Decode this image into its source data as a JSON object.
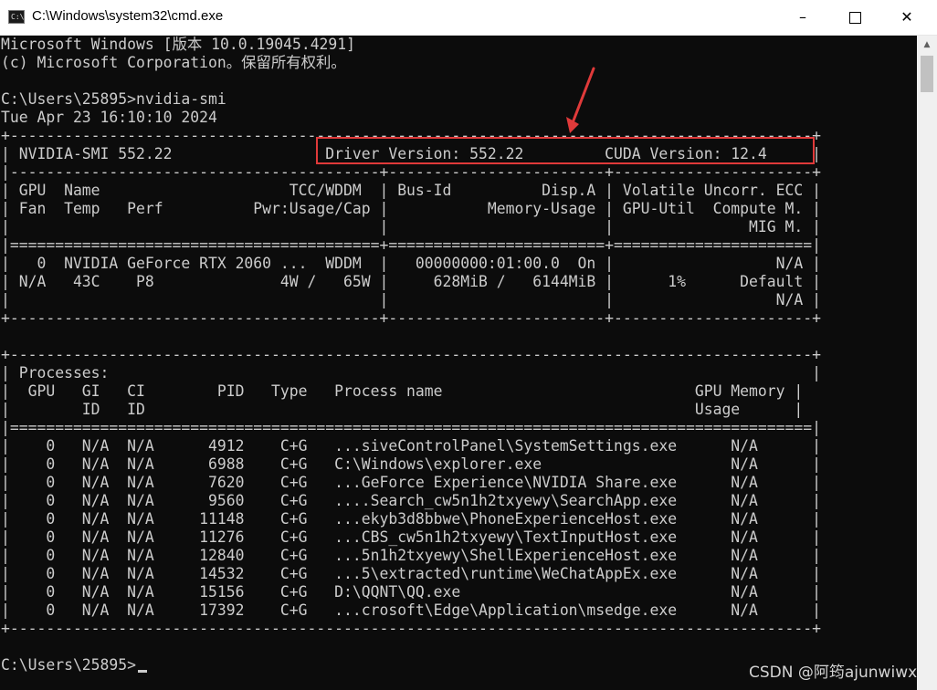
{
  "window": {
    "title": "C:\\Windows\\system32\\cmd.exe",
    "icon_text": "C:\\",
    "buttons": {
      "minimize": "–",
      "close": "✕"
    }
  },
  "console": {
    "lines": [
      "Microsoft Windows [版本 10.0.19045.4291]",
      "(c) Microsoft Corporation。保留所有权利。",
      "",
      "C:\\Users\\25895>nvidia-smi",
      "Tue Apr 23 16:10:10 2024",
      "+-----------------------------------------------------------------------------------------+",
      "| NVIDIA-SMI 552.22                 Driver Version: 552.22         CUDA Version: 12.4     |",
      "|-----------------------------------------+------------------------+----------------------+",
      "| GPU  Name                     TCC/WDDM  | Bus-Id          Disp.A | Volatile Uncorr. ECC |",
      "| Fan  Temp   Perf          Pwr:Usage/Cap |           Memory-Usage | GPU-Util  Compute M. |",
      "|                                         |                        |               MIG M. |",
      "|=========================================+========================+======================|",
      "|   0  NVIDIA GeForce RTX 2060 ...  WDDM  |   00000000:01:00.0  On |                  N/A |",
      "| N/A   43C    P8              4W /   65W |     628MiB /   6144MiB |      1%      Default |",
      "|                                         |                        |                  N/A |",
      "+-----------------------------------------+------------------------+----------------------+",
      "",
      "+-----------------------------------------------------------------------------------------+",
      "| Processes:                                                                              |",
      "|  GPU   GI   CI        PID   Type   Process name                            GPU Memory |",
      "|        ID   ID                                                             Usage      |",
      "|=========================================================================================|",
      "|    0   N/A  N/A      4912    C+G   ...siveControlPanel\\SystemSettings.exe      N/A      |",
      "|    0   N/A  N/A      6988    C+G   C:\\Windows\\explorer.exe                     N/A      |",
      "|    0   N/A  N/A      7620    C+G   ...GeForce Experience\\NVIDIA Share.exe      N/A      |",
      "|    0   N/A  N/A      9560    C+G   ....Search_cw5n1h2txyewy\\SearchApp.exe      N/A      |",
      "|    0   N/A  N/A     11148    C+G   ...ekyb3d8bbwe\\PhoneExperienceHost.exe      N/A      |",
      "|    0   N/A  N/A     11276    C+G   ...CBS_cw5n1h2txyewy\\TextInputHost.exe      N/A      |",
      "|    0   N/A  N/A     12840    C+G   ...5n1h2txyewy\\ShellExperienceHost.exe      N/A      |",
      "|    0   N/A  N/A     14532    C+G   ...5\\extracted\\runtime\\WeChatAppEx.exe      N/A      |",
      "|    0   N/A  N/A     15156    C+G   D:\\QQNT\\QQ.exe                              N/A      |",
      "|    0   N/A  N/A     17392    C+G   ...crosoft\\Edge\\Application\\msedge.exe      N/A      |",
      "+-----------------------------------------------------------------------------------------+",
      "",
      "C:\\Users\\25895>"
    ]
  },
  "watermark": "CSDN @阿筠ajunwiwx",
  "colors": {
    "annotation": "#e03a3a",
    "console_text": "#cccccc",
    "console_bg": "#0c0c0c"
  }
}
